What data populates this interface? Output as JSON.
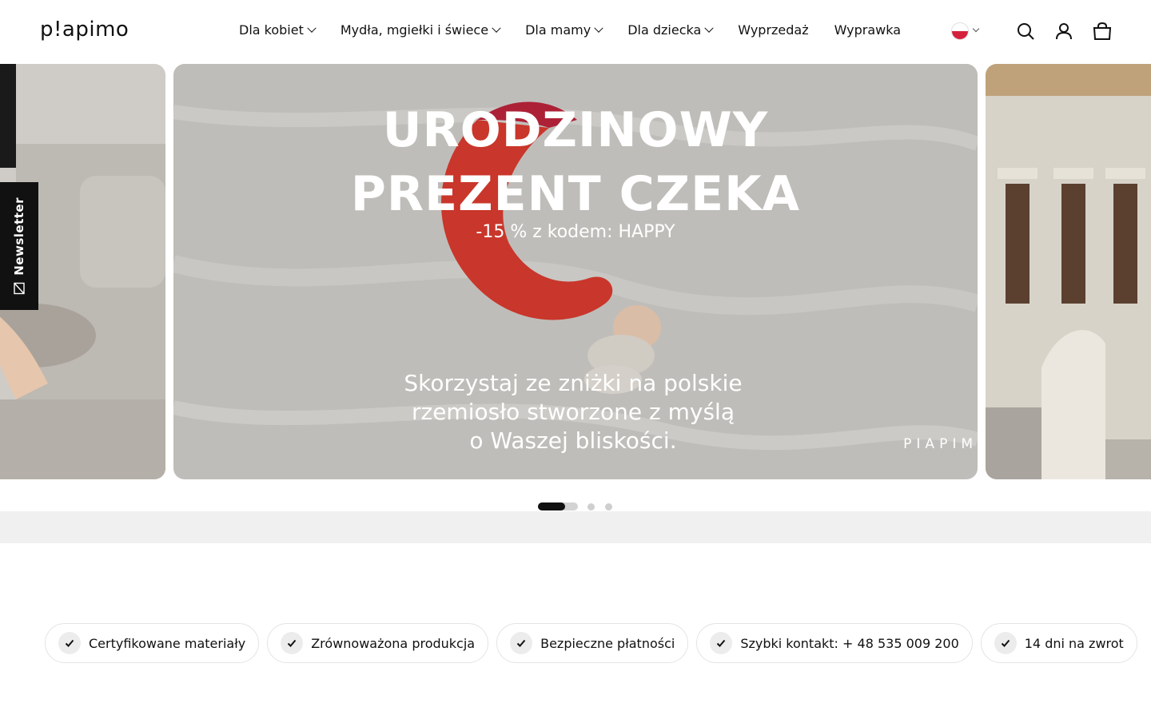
{
  "header": {
    "logo_text": "p!apimo",
    "nav": [
      {
        "label": "Dla kobiet",
        "has_dropdown": true
      },
      {
        "label": "Mydła, mgiełki i świece",
        "has_dropdown": true
      },
      {
        "label": "Dla mamy",
        "has_dropdown": true
      },
      {
        "label": "Dla dziecka",
        "has_dropdown": true
      },
      {
        "label": "Wyprzedaż",
        "has_dropdown": false
      },
      {
        "label": "Wyprawka",
        "has_dropdown": false
      }
    ],
    "language_flag": "PL",
    "icons": [
      "search-icon",
      "account-icon",
      "cart-icon"
    ]
  },
  "hero": {
    "headline_line1": "URODZINOWY",
    "headline_line2": "PREZENT CZEKA",
    "subheadline": "-15 % z kodem: HAPPY",
    "body_line1": "Skorzystaj ze zniżki na polskie",
    "body_line2": "rzemiosło stworzone z myślą",
    "body_line3": "o Waszej bliskości.",
    "watermark": "PIAPIM",
    "slide_count": 4,
    "active_slide": 1
  },
  "newsletter_tab": {
    "label": "Newsletter",
    "icon": "mail-icon"
  },
  "colors": {
    "accent": "#111111",
    "flag_red": "#d4213d",
    "grey_band": "#f0f0f0"
  },
  "trust_badges": [
    {
      "label": "Certyfikowane materiały"
    },
    {
      "label": "Zrównoważona produkcja"
    },
    {
      "label": "Bezpieczne płatności"
    },
    {
      "label": "Szybki kontakt: + 48 535 009 200"
    },
    {
      "label": "14 dni na zwrot"
    }
  ]
}
